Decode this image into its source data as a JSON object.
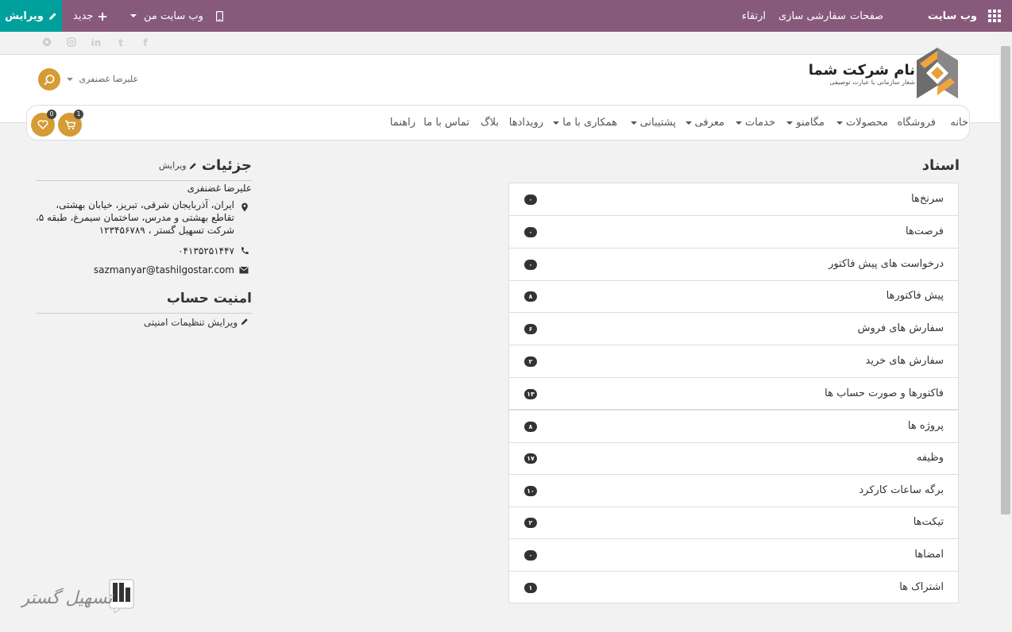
{
  "topbar": {
    "brand": "وب سایت",
    "pages": "صفحات",
    "customize": "سفارشی سازی",
    "upgrade": "ارتقاء",
    "my_website": "وب سایت من",
    "new": "جدید",
    "edit": "ویرایش",
    "color": "#875a7b",
    "edit_color": "#00a09d"
  },
  "header": {
    "company_name": "نام شرکت شما",
    "tagline": "شعار سازمانی یا عبارت توصیفی",
    "user": "علیرضا غضنفری"
  },
  "nav": {
    "items": [
      "خانه",
      "فروشگاه",
      "محصولات",
      "مگامنو",
      "خدمات",
      "معرفی",
      "پشتیبانی",
      "همکاری با ما",
      "رویدادها",
      "بلاگ",
      "تماس با ما",
      "راهنما"
    ],
    "cart_count": "1",
    "wishlist_count": "0"
  },
  "documents": {
    "title": "اسناد",
    "rows": [
      {
        "label": "سرنخ‌ها",
        "count": "۰"
      },
      {
        "label": "فرصت‌ها",
        "count": "۰"
      },
      {
        "label": "درخواست های پیش فاکتور",
        "count": "۰"
      },
      {
        "label": "پیش فاکتورها",
        "count": "۸"
      },
      {
        "label": "سفارش های فروش",
        "count": "۶"
      },
      {
        "label": "سفارش های خرید",
        "count": "۲"
      },
      {
        "label": "فاکتورها و صورت حساب ها",
        "count": "۱۳"
      },
      {
        "label": "پروژه ها",
        "count": "۸"
      },
      {
        "label": "وظیفه",
        "count": "۱۷"
      },
      {
        "label": "برگه ساعات کارکرد",
        "count": "۱۰"
      },
      {
        "label": "تیکت‌ها",
        "count": "۲"
      },
      {
        "label": "امضاها",
        "count": "۰"
      },
      {
        "label": "اشتراک ها",
        "count": "۱"
      }
    ]
  },
  "details": {
    "title": "جزئیات",
    "edit": "ویرایش",
    "name": "علیرضا غضنفری",
    "address": "ایران، آذربایجان شرقی، تبریز، خیابان بهشتی، تقاطع بهشتی و مدرس، ساختمان سیمرغ، طبقه ۵، شرکت تسهیل گستر ، ۱۲۳۴۵۶۷۸۹",
    "phone": "۰۴۱۳۵۲۵۱۴۴۷",
    "email": "sazmanyar@tashilgostar.com"
  },
  "security": {
    "title": "امنیت حساب",
    "link": "ویرایش تنظیمات امنیتی"
  },
  "watermark": "تسهیل گستر",
  "accent": "#d59b34"
}
